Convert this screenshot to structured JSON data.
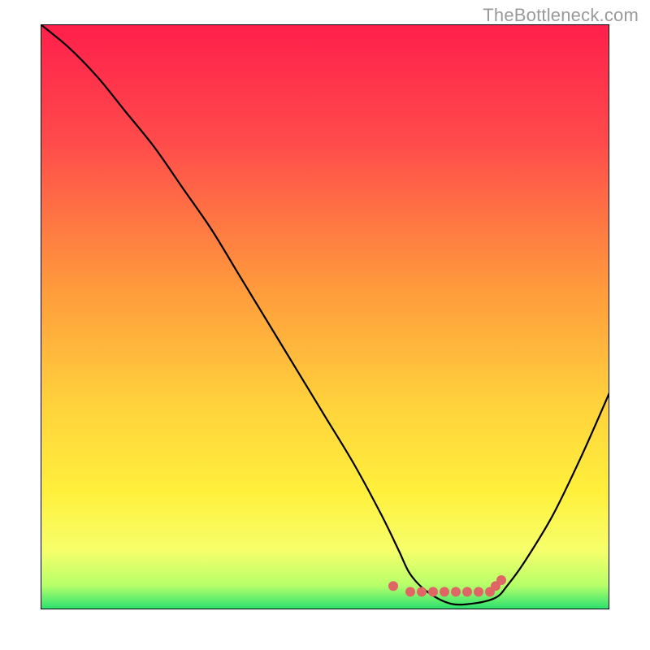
{
  "domain": "Chart",
  "watermark": "TheBottleneck.com",
  "chart_data": {
    "type": "line",
    "title": "",
    "xlabel": "",
    "ylabel": "",
    "xlim": [
      0,
      100
    ],
    "ylim": [
      0,
      100
    ],
    "series": [
      {
        "name": "curve",
        "x": [
          0,
          5,
          10,
          15,
          20,
          25,
          30,
          35,
          40,
          45,
          50,
          55,
          60,
          63,
          65,
          68,
          72,
          76,
          80,
          82,
          85,
          90,
          95,
          100
        ],
        "values": [
          100,
          96,
          91,
          85,
          79,
          72,
          65,
          57,
          49,
          41,
          33,
          25,
          16,
          10,
          6,
          3,
          1,
          1,
          2,
          4,
          8,
          16,
          26,
          37
        ]
      }
    ],
    "highlight_points": {
      "name": "optimal-range",
      "x": [
        62,
        65,
        67,
        69,
        71,
        73,
        75,
        77,
        79,
        80,
        81
      ],
      "values": [
        4,
        3,
        3,
        3,
        3,
        3,
        3,
        3,
        3,
        4,
        5
      ],
      "color": "#E06666"
    },
    "background_gradient": {
      "stops": [
        {
          "offset": 0.0,
          "color": "#FF1F4B"
        },
        {
          "offset": 0.2,
          "color": "#FF4B4B"
        },
        {
          "offset": 0.45,
          "color": "#FF9A3C"
        },
        {
          "offset": 0.65,
          "color": "#FFD23C"
        },
        {
          "offset": 0.8,
          "color": "#FFF03C"
        },
        {
          "offset": 0.9,
          "color": "#F6FF6A"
        },
        {
          "offset": 0.96,
          "color": "#B6FF6A"
        },
        {
          "offset": 1.0,
          "color": "#2BE06F"
        }
      ]
    }
  }
}
